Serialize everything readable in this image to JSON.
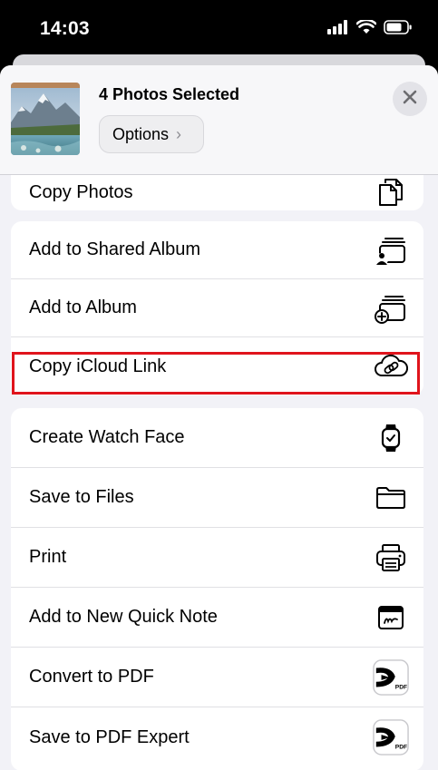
{
  "status_bar": {
    "time": "14:03"
  },
  "share_sheet": {
    "title": "4 Photos Selected",
    "options_label": "Options",
    "options_chevron": "›"
  },
  "actions": {
    "copy_photos": "Copy Photos",
    "add_to_shared_album": "Add to Shared Album",
    "add_to_album": "Add to Album",
    "copy_icloud_link": "Copy iCloud Link",
    "create_watch_face": "Create Watch Face",
    "save_to_files": "Save to Files",
    "print": "Print",
    "add_to_new_quick_note": "Add to New Quick Note",
    "convert_to_pdf": "Convert to PDF",
    "save_to_pdf_expert": "Save to PDF Expert"
  },
  "icons": {
    "copy_photos": "copy-icon",
    "add_to_shared_album": "shared-album-icon",
    "add_to_album": "add-album-icon",
    "copy_icloud_link": "icloud-link-icon",
    "create_watch_face": "watch-icon",
    "save_to_files": "folder-icon",
    "print": "printer-icon",
    "add_to_new_quick_note": "quick-note-icon",
    "convert_to_pdf": "pdf-app-icon",
    "save_to_pdf_expert": "pdf-expert-icon"
  },
  "pdf_badge": "PDF",
  "colors": {
    "highlight": "#e0141c",
    "sheet_background": "#f2f2f7",
    "row_background": "#ffffff"
  }
}
